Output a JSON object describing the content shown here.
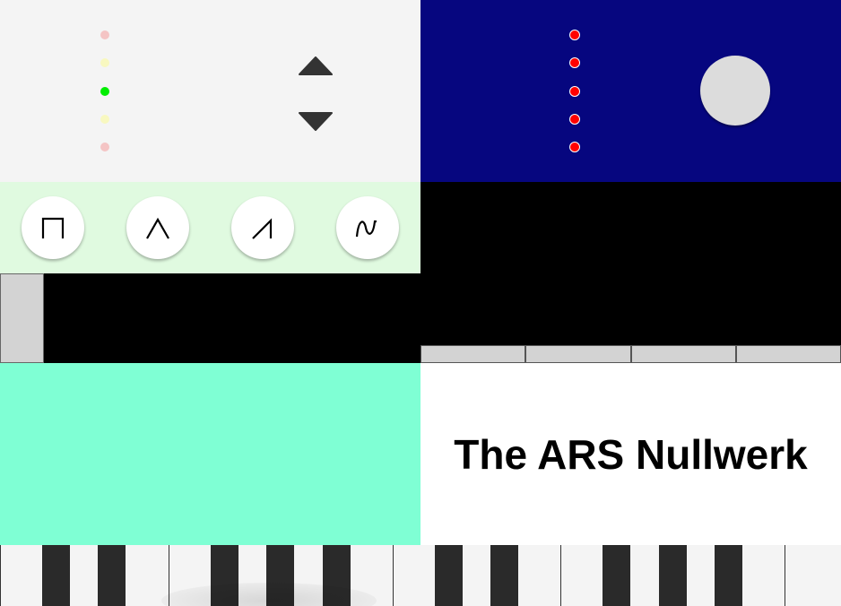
{
  "title": "The ARS Nullwerk",
  "colors": {
    "octave_panel_bg": "#f4f4f4",
    "mod_panel_bg": "#06067f",
    "wave_panel_bg": "#e0fae0",
    "pad_bg": "#7fffd4",
    "title_panel_bg": "#ffffff",
    "black_bg": "#000000",
    "led_active": "#00ee00",
    "led_yellow": "#f8f8c0",
    "led_pink": "#f4c4c4",
    "red_led": "#ff0000",
    "knob": "#dcdcdc",
    "arrow": "#333333"
  },
  "octave": {
    "leds": [
      "pink",
      "yellow",
      "green",
      "yellow",
      "pink"
    ],
    "active_index": 2,
    "up_icon": "triangle-up-icon",
    "down_icon": "triangle-down-icon"
  },
  "modulation": {
    "led_count": 5,
    "knob_icon": "knob"
  },
  "waveforms": [
    {
      "name": "square",
      "icon": "square-wave-icon"
    },
    {
      "name": "triangle",
      "icon": "triangle-wave-icon"
    },
    {
      "name": "sawtooth",
      "icon": "sawtooth-wave-icon"
    },
    {
      "name": "sine",
      "icon": "sine-wave-icon"
    }
  ],
  "segments": 4,
  "keyboard": {
    "white_keys": 15,
    "black_keys": 10
  }
}
